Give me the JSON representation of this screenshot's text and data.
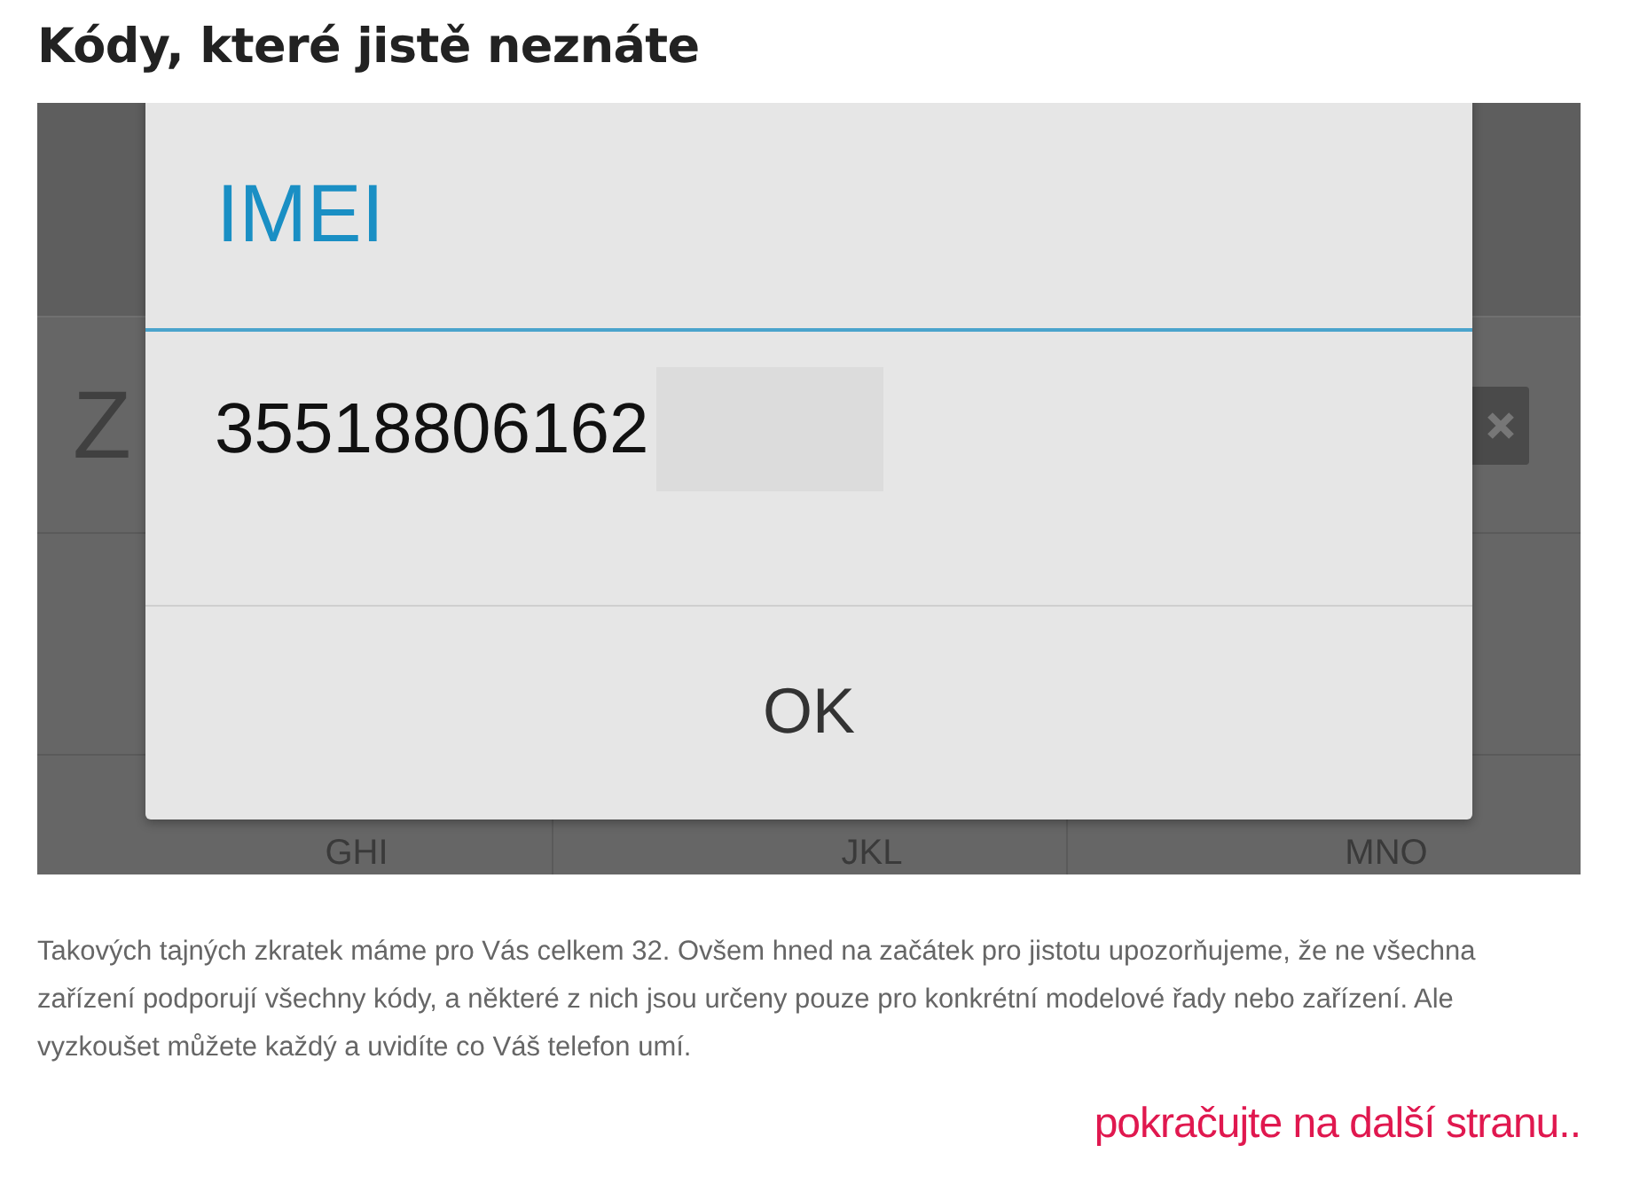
{
  "title": "Kódy, které jistě neznáte",
  "screenshot": {
    "search_text": "Z",
    "dialpad_keys": [
      {
        "letters": "GHI"
      },
      {
        "letters": "JKL"
      },
      {
        "letters": "MNO"
      }
    ],
    "dialog": {
      "title": "IMEI",
      "value": "35518806162",
      "button": "OK"
    }
  },
  "paragraph": "Takových tajných zkratek máme pro Vás celkem 32. Ovšem hned na začátek pro jistotu upozorňujeme, že ne všechna zařízení podporují všechny kódy, a některé z nich jsou určeny pouze pro konkrétní modelové řady nebo zařízení. Ale vyzkoušet můžete každý a uvidíte co Váš telefon umí.",
  "next_link": "pokračujte na další stranu.."
}
